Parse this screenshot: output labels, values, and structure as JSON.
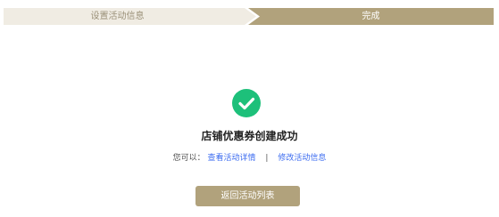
{
  "steps": {
    "step1_label": "设置活动信息",
    "step2_label": "完成"
  },
  "result": {
    "icon": "check-circle-icon",
    "title": "店铺优惠券创建成功",
    "prefix": "您可以：",
    "link_view": "查看活动详情",
    "separator": "|",
    "link_edit": "修改活动信息"
  },
  "button": {
    "back_label": "返回活动列表"
  },
  "colors": {
    "accent": "#b1a27c",
    "success": "#1dc07a",
    "link": "#3c6cf0"
  }
}
